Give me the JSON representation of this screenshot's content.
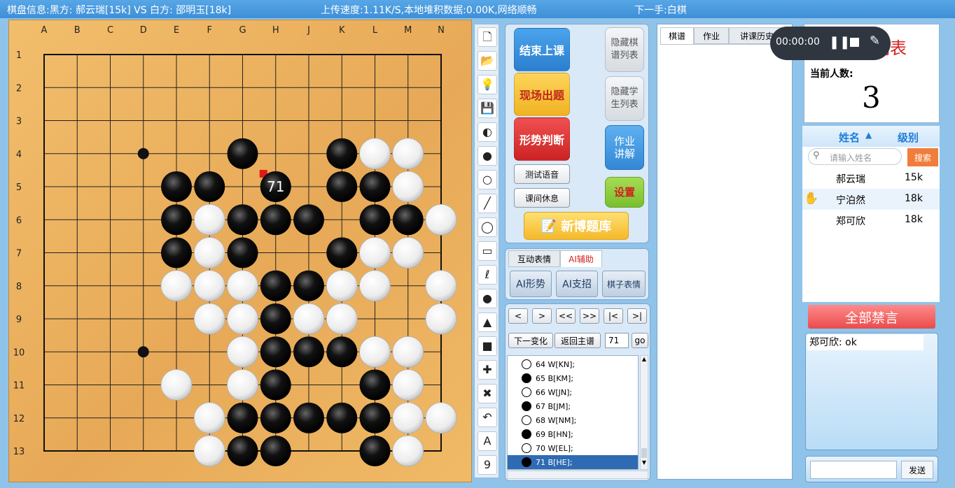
{
  "topbar": {
    "board_info": "棋盘信息:黑方: 郝云瑞[15k] VS 白方: 邵明玉[18k]",
    "upload_status": "上传速度:1.11K/S,本地堆积数据:0.00K,网络顺畅",
    "next_move": "下一手:白棋"
  },
  "board": {
    "col_labels": [
      "A",
      "B",
      "C",
      "D",
      "E",
      "F",
      "G",
      "H",
      "J",
      "K",
      "L",
      "M",
      "N"
    ],
    "row_labels": [
      "1",
      "2",
      "3",
      "4",
      "5",
      "6",
      "7",
      "8",
      "9",
      "10",
      "11",
      "12",
      "13"
    ],
    "star_points": [
      [
        3,
        3
      ],
      [
        3,
        9
      ]
    ],
    "black_stones": [
      [
        6,
        3
      ],
      [
        9,
        3
      ],
      [
        4,
        4
      ],
      [
        5,
        4
      ],
      [
        7,
        4
      ],
      [
        9,
        4
      ],
      [
        10,
        4
      ],
      [
        4,
        5
      ],
      [
        6,
        5
      ],
      [
        7,
        5
      ],
      [
        8,
        5
      ],
      [
        10,
        5
      ],
      [
        11,
        5
      ],
      [
        4,
        6
      ],
      [
        6,
        6
      ],
      [
        9,
        6
      ],
      [
        7,
        7
      ],
      [
        8,
        7
      ],
      [
        7,
        8
      ],
      [
        7,
        9
      ],
      [
        8,
        9
      ],
      [
        9,
        9
      ],
      [
        7,
        10
      ],
      [
        10,
        10
      ],
      [
        6,
        11
      ],
      [
        7,
        11
      ],
      [
        8,
        11
      ],
      [
        9,
        11
      ],
      [
        10,
        11
      ],
      [
        6,
        12
      ],
      [
        7,
        12
      ],
      [
        10,
        12
      ]
    ],
    "white_stones": [
      [
        10,
        3
      ],
      [
        11,
        3
      ],
      [
        11,
        4
      ],
      [
        5,
        5
      ],
      [
        12,
        5
      ],
      [
        5,
        6
      ],
      [
        10,
        6
      ],
      [
        11,
        6
      ],
      [
        4,
        7
      ],
      [
        5,
        7
      ],
      [
        6,
        7
      ],
      [
        9,
        7
      ],
      [
        10,
        7
      ],
      [
        12,
        7
      ],
      [
        5,
        8
      ],
      [
        6,
        8
      ],
      [
        8,
        8
      ],
      [
        9,
        8
      ],
      [
        12,
        8
      ],
      [
        6,
        9
      ],
      [
        10,
        9
      ],
      [
        11,
        9
      ],
      [
        4,
        10
      ],
      [
        6,
        10
      ],
      [
        11,
        10
      ],
      [
        5,
        11
      ],
      [
        11,
        11
      ],
      [
        12,
        11
      ],
      [
        5,
        12
      ],
      [
        11,
        12
      ]
    ],
    "last_move": {
      "col": 7,
      "row": 4,
      "number": "71"
    },
    "last_marker_color": "#e0191b"
  },
  "tools": [
    "new-file-icon",
    "open-folder-icon",
    "idea-icon",
    "save-icon",
    "black-white-stone-icon",
    "black-stone-icon",
    "white-stone-icon",
    "line-icon",
    "circle-icon",
    "rectangle-icon",
    "lasso-icon",
    "dot-icon",
    "triangle-icon",
    "square-icon",
    "plus-icon",
    "cross-icon",
    "undo-icon",
    "text-icon",
    "number-icon"
  ],
  "tool_glyphs": {
    "new-file-icon": "🗋",
    "open-folder-icon": "📂",
    "idea-icon": "💡",
    "save-icon": "💾",
    "black-white-stone-icon": "◐",
    "black-stone-icon": "●",
    "white-stone-icon": "○",
    "line-icon": "╱",
    "circle-icon": "◯",
    "rectangle-icon": "▭",
    "lasso-icon": "ℓ",
    "dot-icon": "●",
    "triangle-icon": "▲",
    "square-icon": "■",
    "plus-icon": "✚",
    "cross-icon": "✖",
    "undo-icon": "↶",
    "text-icon": "A",
    "number-icon": "9"
  },
  "control": {
    "end_class": "结束上课",
    "live_problem": "现场出题",
    "position_judge": "形势判断",
    "test_voice": "测试语音",
    "class_break": "课间休息",
    "hide_record_list": "隐藏棋谱列表",
    "hide_student_list": "隐藏学生列表",
    "homework_explain": "作业讲解",
    "settings": "设置",
    "problem_bank": "新博题库"
  },
  "ai_panel": {
    "tab_emoji": "互动表情",
    "tab_ai": "AI辅助",
    "ai_judge": "AI形势",
    "ai_suggest": "AI支招",
    "stone_emoji": "棋子表情"
  },
  "nav": {
    "buttons": [
      "<",
      ">",
      "<<",
      ">>",
      "|<",
      ">|"
    ],
    "next_variation": "下一变化",
    "back_main": "返回主谱",
    "move_input": "71",
    "go": "go",
    "moves": [
      {
        "color": "white",
        "text": "64 W[KN];"
      },
      {
        "color": "black",
        "text": "65 B[KM];"
      },
      {
        "color": "white",
        "text": "66 W[JN];"
      },
      {
        "color": "black",
        "text": "67 B[JM];"
      },
      {
        "color": "white",
        "text": "68 W[NM];"
      },
      {
        "color": "black",
        "text": "69 B[HN];"
      },
      {
        "color": "white",
        "text": "70 W[EL];"
      },
      {
        "color": "black",
        "text": "71 B[HE];"
      }
    ],
    "selected_index": 7
  },
  "record": {
    "tabs": [
      "棋谱",
      "作业",
      "讲课历史"
    ]
  },
  "timer": {
    "time": "00:00:00"
  },
  "students": {
    "title": "列表",
    "count_label": "当前人数:",
    "count": "3",
    "col_name": "姓名",
    "col_level": "级别",
    "search_placeholder": "请输入姓名",
    "search_button": "搜索",
    "rows": [
      {
        "name": "郝云瑞",
        "level": "15k",
        "hand": false
      },
      {
        "name": "宁泊然",
        "level": "18k",
        "hand": true
      },
      {
        "name": "郑可欣",
        "level": "18k",
        "hand": false
      }
    ],
    "mute_all": "全部禁言",
    "chat_message": "郑可欣: ok",
    "send": "发送"
  },
  "colors": {
    "blue_btn": "#3f95de",
    "red_btn": "#e53b3b",
    "yellow_btn": "#f7c53a",
    "green_btn": "#8ccd3c",
    "accent_red": "#d62020",
    "selected_row": "#2f6bb3",
    "name_header": "#1f7ed8"
  }
}
